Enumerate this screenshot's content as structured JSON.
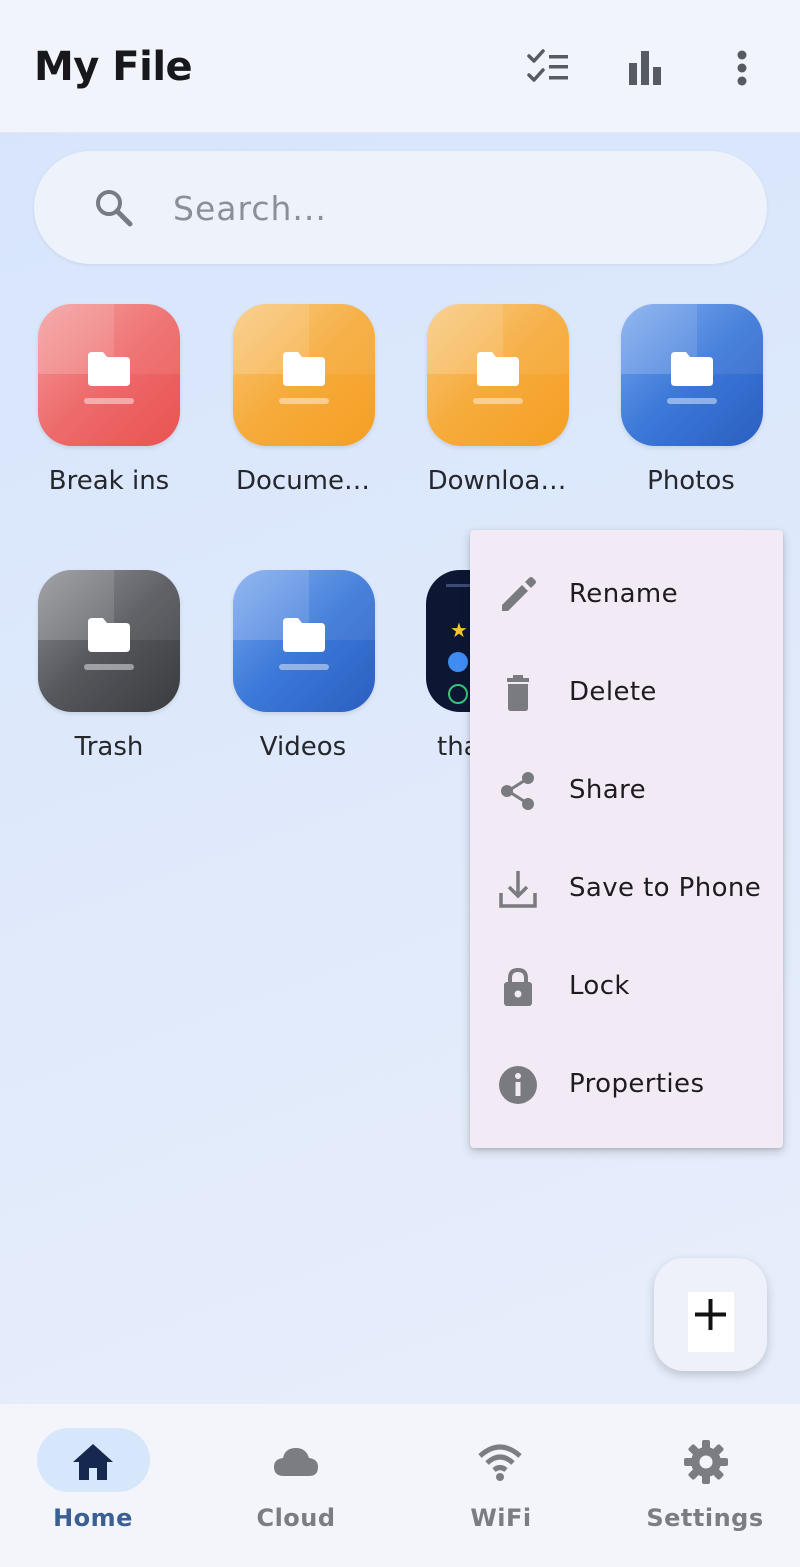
{
  "app": {
    "title": "My File"
  },
  "toolbar": {
    "icons": [
      "checklist-icon",
      "bar-chart-icon",
      "more-vert-icon"
    ]
  },
  "search": {
    "placeholder": "Search..."
  },
  "folders": [
    {
      "label": "Break ins",
      "color": "#ee6b6b"
    },
    {
      "label": "Docume…",
      "color": "#f6ab3b"
    },
    {
      "label": "Downloa…",
      "color": "#f6ab3b"
    },
    {
      "label": "Photos",
      "color": "#3c79d9"
    },
    {
      "label": "Trash",
      "color": "#55575c"
    },
    {
      "label": "Videos",
      "color": "#3c79d9"
    },
    {
      "label": "tha"
    }
  ],
  "context_menu": {
    "items": [
      {
        "label": "Rename",
        "icon": "pencil-icon"
      },
      {
        "label": "Delete",
        "icon": "trash-icon"
      },
      {
        "label": "Share",
        "icon": "share-icon"
      },
      {
        "label": "Save to Phone",
        "icon": "download-icon"
      },
      {
        "label": "Lock",
        "icon": "lock-icon"
      },
      {
        "label": "Properties",
        "icon": "info-icon"
      }
    ]
  },
  "fab": {
    "icon": "plus-icon"
  },
  "bottom_nav": {
    "active": "Home",
    "items": [
      {
        "label": "Home",
        "icon": "home-icon"
      },
      {
        "label": "Cloud",
        "icon": "cloud-icon"
      },
      {
        "label": "WiFi",
        "icon": "wifi-icon"
      },
      {
        "label": "Settings",
        "icon": "gear-icon"
      }
    ]
  },
  "colors": {
    "accent": "#3a5f93",
    "menu_bg": "#f2eaf4",
    "nav_pill": "#d6e6fb"
  }
}
